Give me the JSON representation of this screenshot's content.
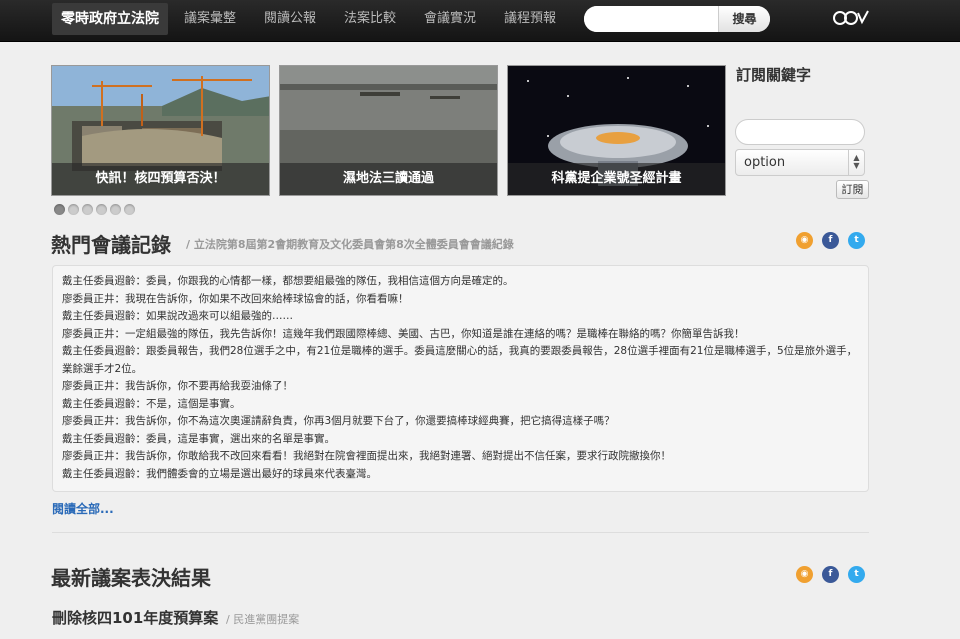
{
  "nav": {
    "brand": "零時政府立法院",
    "items": [
      "議案彙整",
      "閱讀公報",
      "法案比較",
      "會議實況",
      "議程預報"
    ],
    "search_placeholder": "",
    "search_button": "搜尋",
    "logo_icon": "g0v-logo-icon"
  },
  "carousel": {
    "slides": [
      {
        "caption": "快訊！核四預算否決！",
        "icon": "construction-site-image"
      },
      {
        "caption": "濕地法三讀通過",
        "icon": "wetland-image"
      },
      {
        "caption": "科黨提企業號圣經計畫",
        "icon": "starship-image"
      }
    ],
    "dot_count": 6,
    "active_dot": 0
  },
  "subscribe": {
    "title": "訂閱關鍵字",
    "input_value": "",
    "select_value": "option",
    "button": "訂閱"
  },
  "meeting": {
    "title": "熱門會議記錄",
    "subtitle": "/ 立法院第8屆第2會期教育及文化委員會第8次全體委員會會議紀錄",
    "lines": [
      "戴主任委員遐齡：委員，你跟我的心情都一樣，都想要組最強的隊伍，我相信這個方向是確定的。",
      "廖委員正井：我現在告訴你，你如果不改回來給棒球協會的話，你看看嘛！",
      "戴主任委員遐齡：如果說改過來可以組最強的……",
      "廖委員正井：一定組最強的隊伍，我先告訴你！這幾年我們跟國際棒總、美國、古巴，你知道是誰在連絡的嗎？是職棒在聯絡的嗎？你簡單告訴我！",
      "戴主任委員遐齡：跟委員報告，我們28位選手之中，有21位是職棒的選手。委員這麼關心的話，我真的要跟委員報告，28位選手裡面有21位是職棒選手，5位是旅外選手，業餘選手才2位。",
      "廖委員正井：我告訴你，你不要再給我耍油條了！",
      "戴主任委員遐齡：不是，這個是事實。",
      "廖委員正井：我告訴你，你不為這次奧運請辭負責，你再3個月就要下台了，你還要搞棒球經典賽，把它搞得這樣子嗎？",
      "戴主任委員遐齡：委員，這是事實，選出來的名單是事實。",
      "廖委員正井：我告訴你，你敢給我不改回來看看！我絕對在院會裡面提出來，我絕對連署、絕對提出不信任案，要求行政院撤換你！",
      "戴主任委員遐齡：我們體委會的立場是選出最好的球員來代表臺灣。"
    ],
    "read_all": "閱讀全部..."
  },
  "results": {
    "title": "最新議案表決結果",
    "bill_title": "刪除核四101年度預算案",
    "bill_subtitle": "/ 民進黨團提案"
  },
  "social": {
    "rss": "rss-icon",
    "facebook": "facebook-icon",
    "twitter": "twitter-icon"
  }
}
